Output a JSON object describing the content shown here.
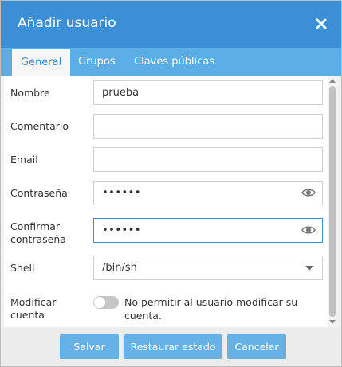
{
  "dialog": {
    "title": "Añadir usuario",
    "close_icon": "close-icon"
  },
  "tabs": [
    {
      "label": "General",
      "active": true
    },
    {
      "label": "Grupos",
      "active": false
    },
    {
      "label": "Claves públicas",
      "active": false
    }
  ],
  "form": {
    "nombre": {
      "label": "Nombre",
      "value": "prueba"
    },
    "comentario": {
      "label": "Comentario",
      "value": ""
    },
    "email": {
      "label": "Email",
      "value": ""
    },
    "contrasena": {
      "label": "Contraseña",
      "value": "••••••",
      "icon": "eye-icon"
    },
    "confirmar": {
      "label": "Confirmar contraseña",
      "label_line1": "Confirmar",
      "label_line2": "contraseña",
      "value": "••••••",
      "icon": "eye-icon"
    },
    "shell": {
      "label": "Shell",
      "value": "/bin/sh",
      "icon": "chevron-down-icon"
    },
    "modificar": {
      "label": "Modificar cuenta",
      "label_line1": "Modificar",
      "label_line2": "cuenta",
      "text_line1": "No permitir al usuario modificar su",
      "text_line2": "cuenta.",
      "enabled": false
    }
  },
  "buttons": {
    "save": "Salvar",
    "reset": "Restaurar estado",
    "cancel": "Cancelar"
  },
  "colors": {
    "titlebar": "#3a8fd6",
    "tabbar": "#5aaee5",
    "button": "#66b1e8",
    "focus_border": "#3a8fd6"
  }
}
